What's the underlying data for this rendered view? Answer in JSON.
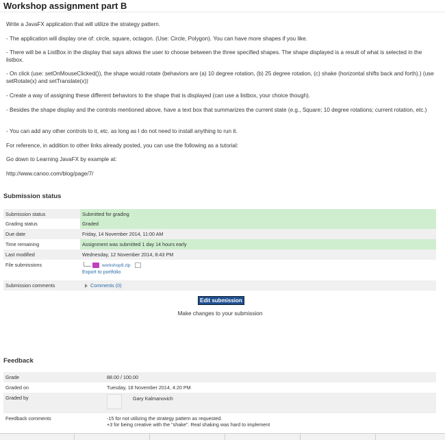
{
  "page_title": "Workshop assignment part B",
  "intro": [
    "Write a JavaFX application that will utilize the strategy pattern.",
    "- The application will display one of: circle, square, octagon. (Use: Circle, Polygon). You can have more shapes if you like.",
    "- There will be a ListBox in the display that says allows the user to choose between the three specified shapes. The shape displayed is a result of what is selected in the listbox.",
    "- On click (use: setOnMouseClicked()), the shape would rotate (behaviors are (a) 10 degree rotation, (b) 25 degree rotation, (c) shake (horizontal shifts back and forth).) (use setRotate(x) and setTranslate(x))",
    "- Create a way of assigning these different behaviors to the shape that is displayed (can use a listbox, your choice though).",
    "- Besides the shape display and the controls mentioned above, have a text box that summarizes the current state (e.g., Square; 10 degree rotations; current rotation, etc.)",
    "- You can add any other controls to it, etc. as long as I do not need to install anything to run it.",
    "For reference, in addition to other links already posted, you can use the following as a tutorial:",
    "Go down to Learning JavaFX by example at:",
    "http://www.canoo.com/blog/page/7/"
  ],
  "submission": {
    "heading": "Submission status",
    "rows": {
      "status_label": "Submission status",
      "status_value": "Submitted for grading",
      "grading_label": "Grading status",
      "grading_value": "Graded",
      "due_label": "Due date",
      "due_value": "Friday, 14 November 2014, 11:00 AM",
      "time_label": "Time remaining",
      "time_value": "Assignment was submitted 1 day 14 hours early",
      "modified_label": "Last modified",
      "modified_value": "Wednesday, 12 November 2014, 8:43 PM",
      "files_label": "File submissions",
      "file_name": "workshop9.zip",
      "export_link": "Export to portfolio",
      "comments_label": "Submission comments",
      "comments_link": "Comments (0)"
    },
    "edit_button": "Edit submission",
    "edit_desc": "Make changes to your submission"
  },
  "feedback": {
    "heading": "Feedback",
    "grade_label": "Grade",
    "grade_value": "88.00 / 100.00",
    "graded_on_label": "Graded on",
    "graded_on_value": "Tuesday, 18 November 2014, 4:20 PM",
    "graded_by_label": "Graded by",
    "graded_by_value": "Gary Kalmanovich",
    "comments_label": "Feedback comments",
    "comment_line1": "-15 for not utilizing the strategy pattern as requested.",
    "comment_line2": "+3 for being creative with the \"shake\". Real shaking was hard to implement"
  },
  "colors": {
    "success_bg": "#cfeecf",
    "row_alt_bg": "#f0f0f0",
    "button_bg": "#1f4e8f",
    "link": "#2b6aa8"
  }
}
